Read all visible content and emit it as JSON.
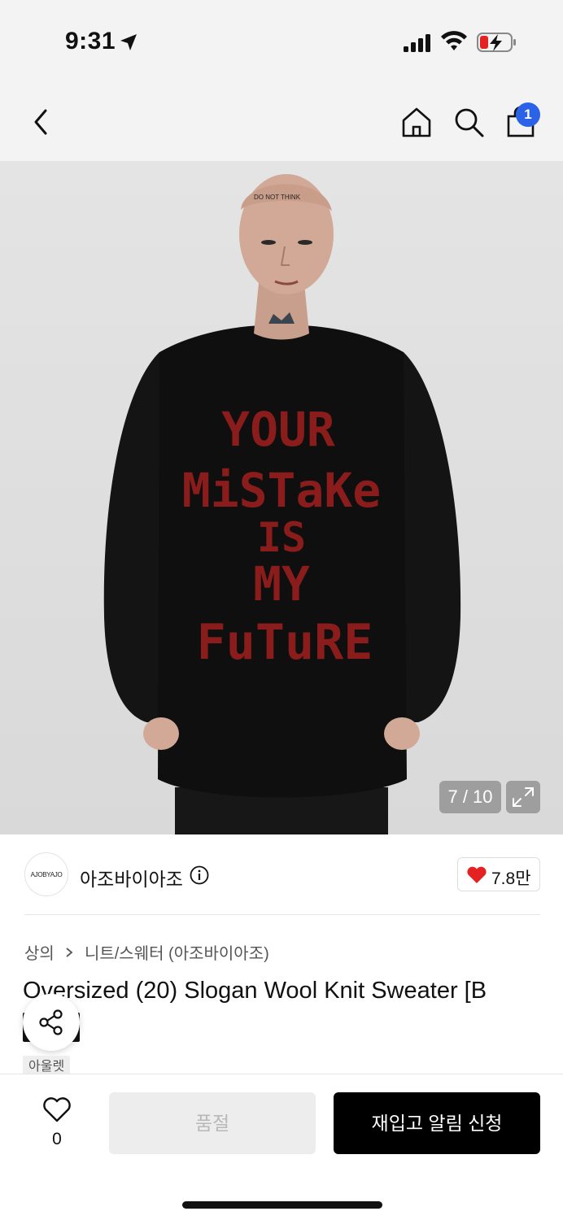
{
  "status_bar": {
    "time": "9:31"
  },
  "nav": {
    "cart_count": "1"
  },
  "gallery": {
    "counter": "7 / 10",
    "sweater_text": [
      "YOUR",
      "MiSTaKe",
      "IS",
      "MY",
      "FuTuRE"
    ]
  },
  "brand": {
    "logo_text": "AJOBYAJO",
    "name": "아조바이아조",
    "like_count": "7.8만"
  },
  "breadcrumb": {
    "level1": "상의",
    "level2": "니트/스웨터 (아조바이아조)"
  },
  "product": {
    "title": "Oversized (20) Slogan Wool Knit Sweater [B",
    "tag": "아울렛"
  },
  "bottom_bar": {
    "wish_count": "0",
    "soldout_label": "품절",
    "restock_label": "재입고 알림 신청"
  },
  "colors": {
    "accent": "#2a63e8",
    "heart": "#e52222",
    "button_dark": "#000000",
    "disabled_bg": "#ededed"
  }
}
